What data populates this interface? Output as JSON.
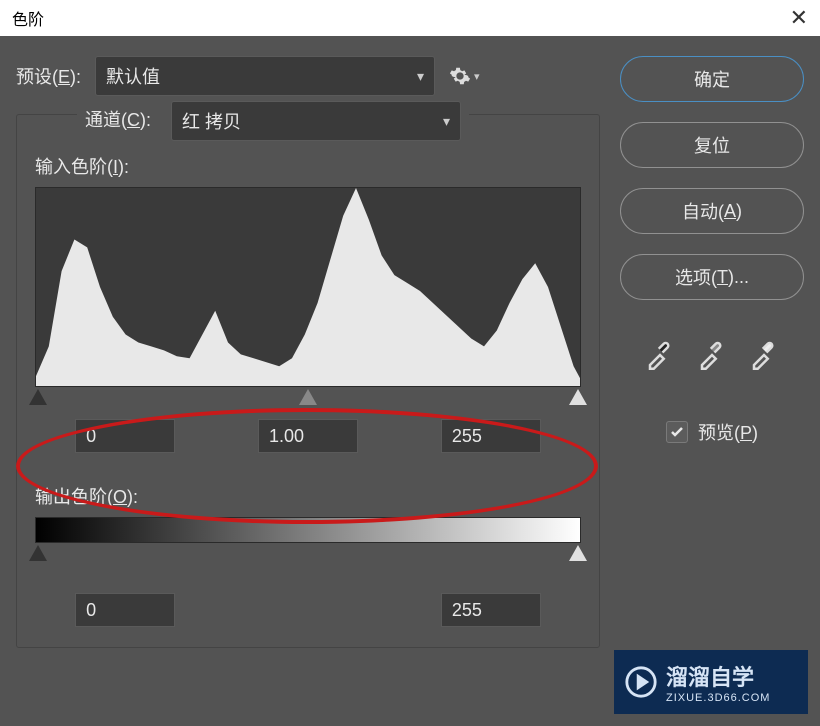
{
  "window": {
    "title": "色阶"
  },
  "preset": {
    "label_prefix": "预设(",
    "label_hot": "E",
    "label_suffix": "):",
    "value": "默认值"
  },
  "channel": {
    "label_prefix": "通道(",
    "label_hot": "C",
    "label_suffix": "):",
    "value": "红 拷贝"
  },
  "input_levels": {
    "label_prefix": "输入色阶(",
    "label_hot": "I",
    "label_suffix": "):",
    "shadow": "0",
    "mid": "1.00",
    "highlight": "255"
  },
  "output_levels": {
    "label_prefix": "输出色阶(",
    "label_hot": "O",
    "label_suffix": "):",
    "shadow": "0",
    "highlight": "255"
  },
  "buttons": {
    "ok": "确定",
    "reset": "复位",
    "auto_prefix": "自动(",
    "auto_hot": "A",
    "auto_suffix": ")",
    "options_prefix": "选项(",
    "options_hot": "T",
    "options_suffix": ")..."
  },
  "preview": {
    "label_prefix": "预览(",
    "label_hot": "P",
    "label_suffix": ")",
    "checked": true
  },
  "watermark": {
    "brand": "溜溜自学",
    "url": "ZIXUE.3D66.COM"
  },
  "chart_data": {
    "type": "area",
    "title": "",
    "xlabel": "",
    "ylabel": "",
    "xlim": [
      0,
      255
    ],
    "ylim": [
      0,
      100
    ],
    "x": [
      0,
      6,
      12,
      18,
      24,
      30,
      36,
      42,
      48,
      54,
      60,
      66,
      72,
      78,
      84,
      90,
      96,
      102,
      108,
      114,
      120,
      126,
      132,
      138,
      144,
      150,
      156,
      162,
      168,
      174,
      180,
      186,
      192,
      198,
      204,
      210,
      216,
      222,
      228,
      234,
      240,
      246,
      252,
      255
    ],
    "values": [
      5,
      20,
      58,
      74,
      70,
      50,
      35,
      26,
      22,
      20,
      18,
      15,
      14,
      26,
      38,
      22,
      16,
      14,
      12,
      10,
      14,
      26,
      42,
      64,
      86,
      100,
      84,
      66,
      56,
      52,
      48,
      42,
      36,
      30,
      24,
      20,
      28,
      42,
      54,
      62,
      50,
      30,
      10,
      4
    ]
  }
}
